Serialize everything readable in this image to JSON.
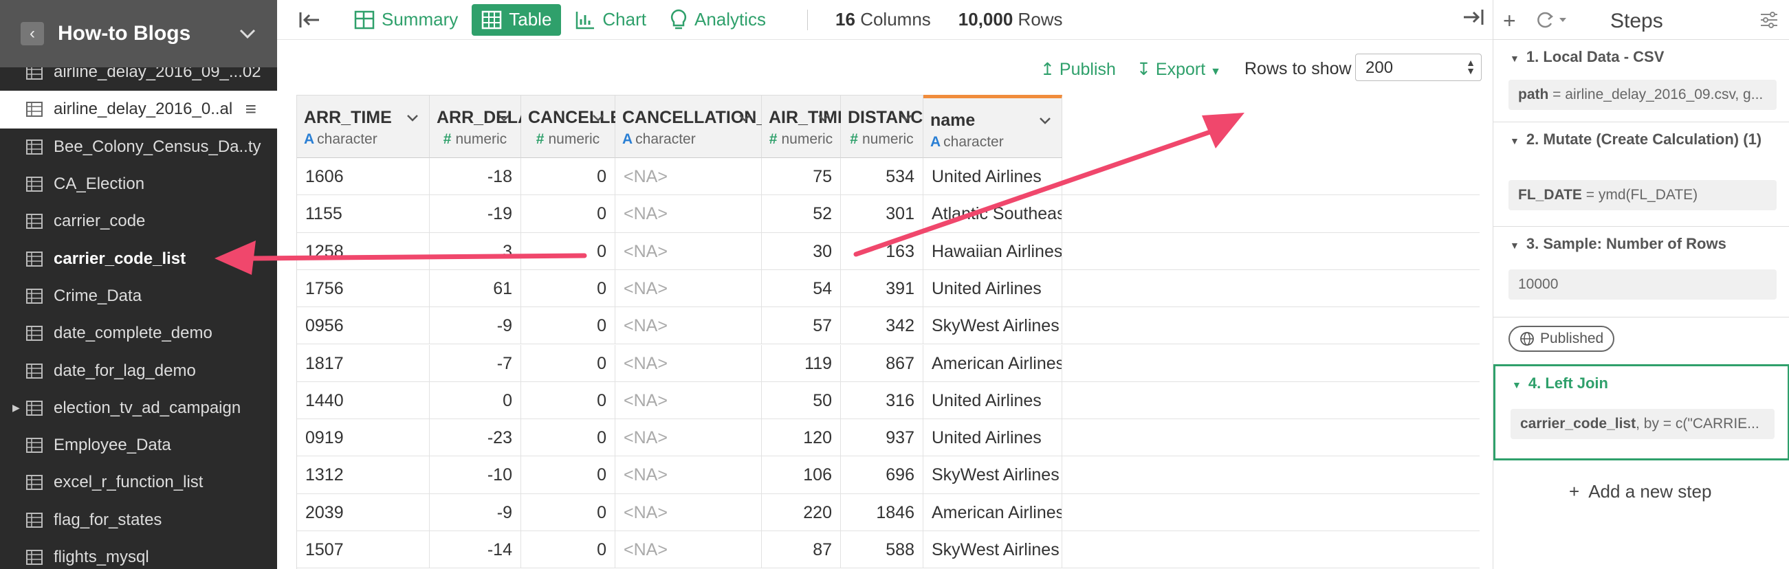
{
  "sidebar": {
    "title": "How-to Blogs",
    "items": [
      {
        "label": "airline_delay_2016_09_...02"
      },
      {
        "label": "airline_delay_2016_0..al"
      },
      {
        "label": "Bee_Colony_Census_Da..ty"
      },
      {
        "label": "CA_Election"
      },
      {
        "label": "carrier_code"
      },
      {
        "label": "carrier_code_list"
      },
      {
        "label": "Crime_Data"
      },
      {
        "label": "date_complete_demo"
      },
      {
        "label": "date_for_lag_demo"
      },
      {
        "label": "election_tv_ad_campaign"
      },
      {
        "label": "Employee_Data"
      },
      {
        "label": "excel_r_function_list"
      },
      {
        "label": "flag_for_states"
      },
      {
        "label": "flights_mysql"
      }
    ]
  },
  "toolbar": {
    "tabs": [
      {
        "label": "Summary",
        "icon": "summary-icon"
      },
      {
        "label": "Table",
        "icon": "table-icon"
      },
      {
        "label": "Chart",
        "icon": "chart-icon"
      },
      {
        "label": "Analytics",
        "icon": "bulb-icon"
      }
    ],
    "columns_count": "16",
    "columns_label": "Columns",
    "rows_count": "10,000",
    "rows_label": "Rows"
  },
  "subbar": {
    "publish_label": "Publish",
    "export_label": "Export",
    "rows_to_show_label": "Rows to show",
    "rows_to_show_value": "200"
  },
  "grid": {
    "columns": [
      {
        "name": "ARR_TIME",
        "type": "character"
      },
      {
        "name": "ARR_DELAY",
        "type": "numeric"
      },
      {
        "name": "CANCELLED",
        "type": "numeric"
      },
      {
        "name": "CANCELLATION_CODE",
        "type": "character"
      },
      {
        "name": "AIR_TIME",
        "type": "numeric"
      },
      {
        "name": "DISTANCE",
        "type": "numeric"
      },
      {
        "name": "name",
        "type": "character"
      }
    ],
    "rows": [
      [
        "1606",
        "-18",
        "0",
        "<NA>",
        "75",
        "534",
        "United Airlines"
      ],
      [
        "1155",
        "-19",
        "0",
        "<NA>",
        "52",
        "301",
        "Atlantic Southeast Airlines"
      ],
      [
        "1258",
        "3",
        "0",
        "<NA>",
        "30",
        "163",
        "Hawaiian Airlines"
      ],
      [
        "1756",
        "61",
        "0",
        "<NA>",
        "54",
        "391",
        "United Airlines"
      ],
      [
        "0956",
        "-9",
        "0",
        "<NA>",
        "57",
        "342",
        "SkyWest Airlines"
      ],
      [
        "1817",
        "-7",
        "0",
        "<NA>",
        "119",
        "867",
        "American Airlines"
      ],
      [
        "1440",
        "0",
        "0",
        "<NA>",
        "50",
        "316",
        "United Airlines"
      ],
      [
        "0919",
        "-23",
        "0",
        "<NA>",
        "120",
        "937",
        "United Airlines"
      ],
      [
        "1312",
        "-10",
        "0",
        "<NA>",
        "106",
        "696",
        "SkyWest Airlines"
      ],
      [
        "2039",
        "-9",
        "0",
        "<NA>",
        "220",
        "1846",
        "American Airlines"
      ],
      [
        "1507",
        "-14",
        "0",
        "<NA>",
        "87",
        "588",
        "SkyWest Airlines"
      ]
    ]
  },
  "steps": {
    "title": "Steps",
    "items": [
      {
        "title": "1. Local Data - CSV",
        "body_key": "path",
        "body_rest": " = airline_delay_2016_09.csv, g..."
      },
      {
        "title": "2. Mutate (Create Calculation) (1)",
        "body_key": "FL_DATE",
        "body_rest": " = ymd(FL_DATE)"
      },
      {
        "title": "3. Sample: Number of Rows",
        "body_key": "",
        "body_rest": "10000"
      },
      {
        "title": "4. Left Join",
        "body_key": "carrier_code_list",
        "body_rest": ", by = c(\"CARRIE..."
      }
    ],
    "published_label": "Published",
    "add_step_label": "Add a new step"
  },
  "colors": {
    "accent": "#2fa06b",
    "arrow": "#f0476c",
    "highlight_border": "#f08c3c"
  }
}
